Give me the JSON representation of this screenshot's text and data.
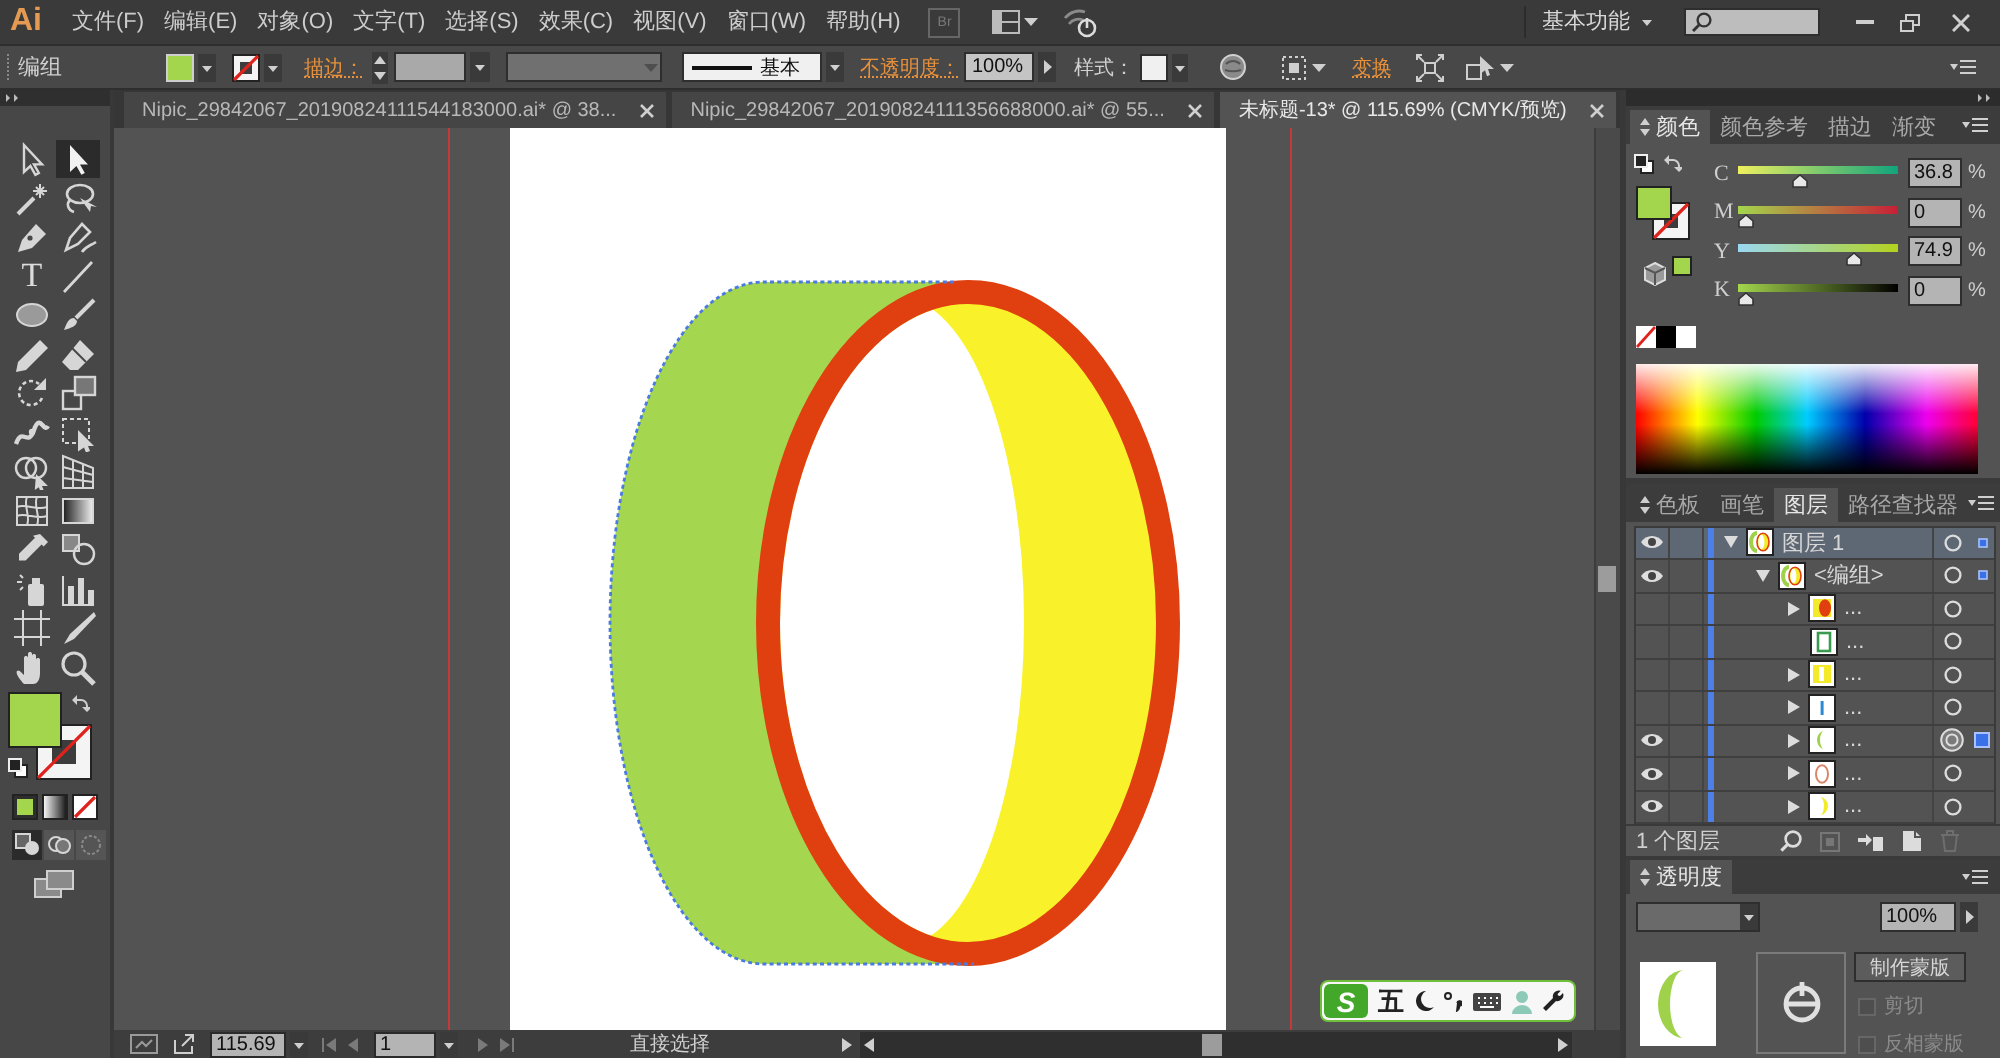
{
  "app": {
    "logo": "Ai",
    "bridge": "Br"
  },
  "menu": [
    "文件(F)",
    "编辑(E)",
    "对象(O)",
    "文字(T)",
    "选择(S)",
    "效果(C)",
    "视图(V)",
    "窗口(W)",
    "帮助(H)"
  ],
  "workspace": {
    "label": "基本功能"
  },
  "control_bar": {
    "selection": "编组",
    "stroke_label": "描边：",
    "stroke_profile": "基本",
    "opacity_label": "不透明度：",
    "opacity": "100%",
    "style_label": "样式：",
    "transform_label": "变换"
  },
  "current_colors": {
    "fill": {
      "color": "#a3d64c"
    },
    "stroke": {
      "none": true
    }
  },
  "tabs": [
    {
      "label": "Nipic_29842067_20190824111544183000.ai* @ 38...",
      "selected": false
    },
    {
      "label": "Nipic_29842067_20190824111356688000.ai* @ 55...",
      "selected": false
    },
    {
      "label": "未标题-13* @ 115.69% (CMYK/预览)",
      "selected": true
    }
  ],
  "tools": [
    {
      "kind": "selection",
      "selected": false
    },
    {
      "kind": "direct-selection",
      "selected": true
    },
    {
      "kind": "magic-wand",
      "selected": false
    },
    {
      "kind": "lasso",
      "selected": false
    },
    {
      "kind": "pen",
      "selected": false
    },
    {
      "kind": "curvature",
      "selected": false
    },
    {
      "kind": "type",
      "glyph": "T",
      "selected": false
    },
    {
      "kind": "line",
      "selected": false
    },
    {
      "kind": "ellipse",
      "selected": false
    },
    {
      "kind": "paintbrush",
      "selected": false
    },
    {
      "kind": "pencil",
      "selected": false
    },
    {
      "kind": "eraser",
      "selected": false
    },
    {
      "kind": "rotate",
      "selected": false
    },
    {
      "kind": "scale",
      "selected": false
    },
    {
      "kind": "width",
      "selected": false
    },
    {
      "kind": "free-transform",
      "selected": false
    },
    {
      "kind": "shape-builder",
      "selected": false
    },
    {
      "kind": "perspective-grid",
      "selected": false
    },
    {
      "kind": "mesh",
      "selected": false
    },
    {
      "kind": "gradient",
      "selected": false
    },
    {
      "kind": "eyedropper",
      "selected": false
    },
    {
      "kind": "blend",
      "selected": false
    },
    {
      "kind": "symbol-sprayer",
      "selected": false
    },
    {
      "kind": "column-graph",
      "selected": false
    },
    {
      "kind": "artboard",
      "selected": false
    },
    {
      "kind": "slice",
      "selected": false
    },
    {
      "kind": "hand",
      "selected": false
    },
    {
      "kind": "zoom",
      "selected": false
    }
  ],
  "drawing_modes": [
    {
      "kind": "normal",
      "selected": true
    },
    {
      "kind": "behind",
      "selected": false
    },
    {
      "kind": "inside",
      "selected": false
    }
  ],
  "color_panel": {
    "tabs": [
      {
        "label": "颜色",
        "selected": true
      },
      {
        "label": "颜色参考",
        "selected": false
      },
      {
        "label": "描边",
        "selected": false
      },
      {
        "label": "渐变",
        "selected": false
      }
    ],
    "channels": [
      {
        "name": "C",
        "value": "36.8",
        "unit": "%",
        "level": 0.37
      },
      {
        "name": "M",
        "value": "0",
        "unit": "%",
        "level": 0
      },
      {
        "name": "Y",
        "value": "74.9",
        "unit": "%",
        "level": 0.75
      },
      {
        "name": "K",
        "value": "0",
        "unit": "%",
        "level": 0
      }
    ]
  },
  "layers_panel": {
    "tabs": [
      {
        "label": "色板",
        "selected": false
      },
      {
        "label": "画笔",
        "selected": false
      },
      {
        "label": "图层",
        "selected": true
      },
      {
        "label": "路径查找器",
        "selected": false
      }
    ],
    "layers": [
      {
        "name": "图层 1",
        "kind": "layer",
        "visible": true,
        "expanded": true,
        "selected": true,
        "has_selected_art": true,
        "targeted": false,
        "thumbnail": {
          "kind": "ring"
        },
        "children": [
          {
            "name": "<编组>",
            "kind": "group",
            "visible": true,
            "expanded": true,
            "selected": false,
            "has_selected_art": true,
            "targeted": false,
            "thumbnail": {
              "kind": "ring"
            },
            "children": [
              {
                "name": "...",
                "kind": "group",
                "visible": false,
                "expanded": false,
                "selected": false,
                "has_selected_art": false,
                "targeted": false,
                "thumbnail": {
                  "kind": "red-oval"
                }
              },
              {
                "name": "...",
                "kind": "path",
                "visible": false,
                "selected": false,
                "has_selected_art": false,
                "targeted": false,
                "thumbnail": {
                  "kind": "green-frame"
                }
              },
              {
                "name": "...",
                "kind": "group",
                "visible": false,
                "expanded": false,
                "selected": false,
                "has_selected_art": false,
                "targeted": false,
                "thumbnail": {
                  "kind": "yellow-band"
                }
              },
              {
                "name": "...",
                "kind": "group",
                "visible": false,
                "expanded": false,
                "selected": false,
                "has_selected_art": false,
                "targeted": false,
                "thumbnail": {
                  "kind": "blue-line"
                }
              },
              {
                "name": "...",
                "kind": "group",
                "visible": true,
                "expanded": false,
                "selected": false,
                "has_selected_art": true,
                "targeted": true,
                "thumbnail": {
                  "kind": "green-crescent"
                }
              },
              {
                "name": "...",
                "kind": "group",
                "visible": true,
                "expanded": false,
                "selected": false,
                "has_selected_art": false,
                "targeted": false,
                "thumbnail": {
                  "kind": "oval-outline"
                }
              },
              {
                "name": "...",
                "kind": "group",
                "visible": true,
                "expanded": false,
                "selected": false,
                "has_selected_art": false,
                "targeted": false,
                "thumbnail": {
                  "kind": "yellow-crescent"
                }
              }
            ]
          }
        ]
      }
    ],
    "footer": "1 个图层"
  },
  "transparency_panel": {
    "tab": "透明度",
    "opacity": "100%",
    "mask_button": "制作蒙版",
    "options": [
      {
        "label": "剪切",
        "checked": false,
        "disabled": true
      },
      {
        "label": "反相蒙版",
        "checked": false,
        "disabled": true
      }
    ]
  },
  "status_bar": {
    "zoom": "115.69",
    "page": "1",
    "tool": "直接选择"
  },
  "ime_bar": {
    "logo": "S",
    "mode": "五"
  }
}
